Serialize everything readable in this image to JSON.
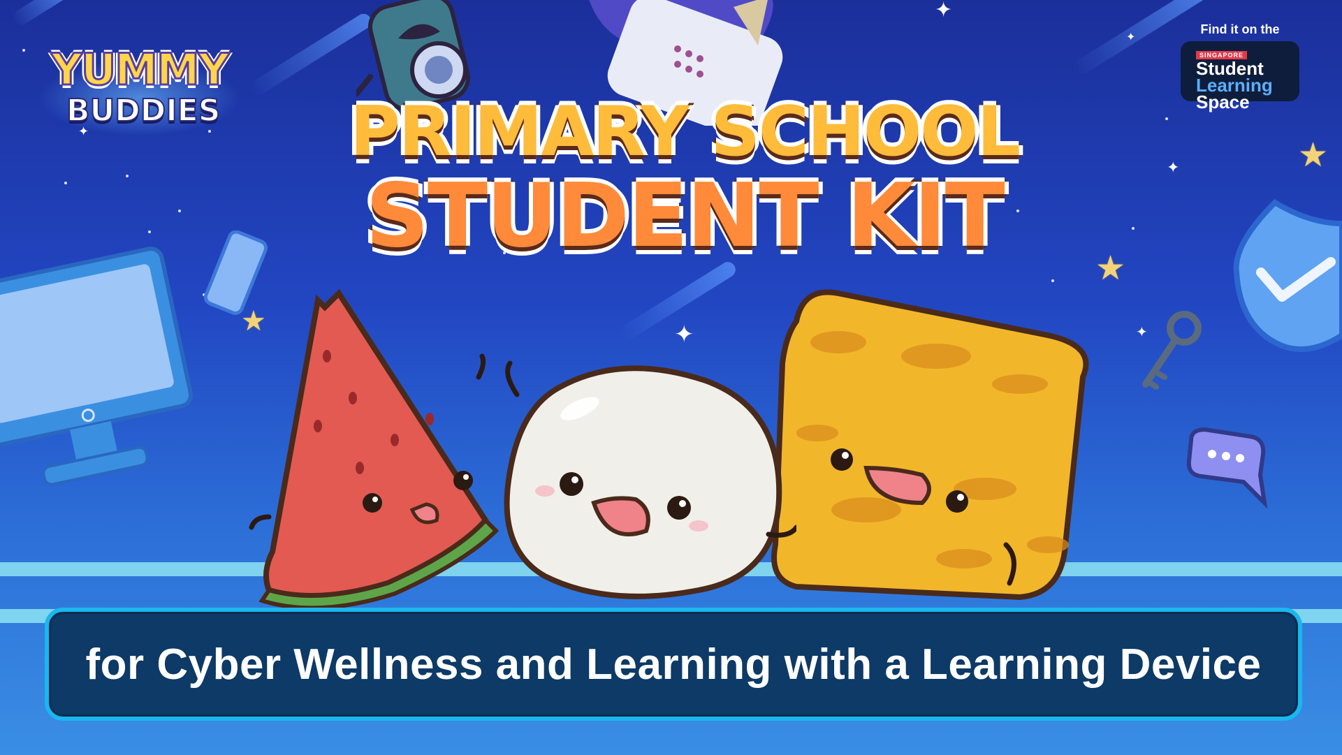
{
  "logo": {
    "line1": "YUMMY",
    "line2": "BUDDIES"
  },
  "badge": {
    "find_text": "Find it on the",
    "country": "SINGAPORE",
    "line1": "Student",
    "line2": "Learning",
    "line3": "Space"
  },
  "title": {
    "line1": "PRIMARY SCHOOL",
    "line2": "STUDENT KIT"
  },
  "caption": "for Cyber Wellness and Learning with a Learning Device",
  "colors": {
    "background_top": "#1b2f9a",
    "background_bottom": "#3a8ee4",
    "title_line1": "#ffbb3a",
    "title_line2": "#ff8a3a",
    "caption_box": "#0d3a66",
    "caption_border": "#1ab7ee"
  },
  "illustrations": [
    "computer-monitor",
    "smartphone",
    "rocket",
    "spaceship",
    "security-shield",
    "key",
    "chat-bubble",
    "watermelon-character",
    "white-cake-character",
    "yellow-cake-character"
  ]
}
